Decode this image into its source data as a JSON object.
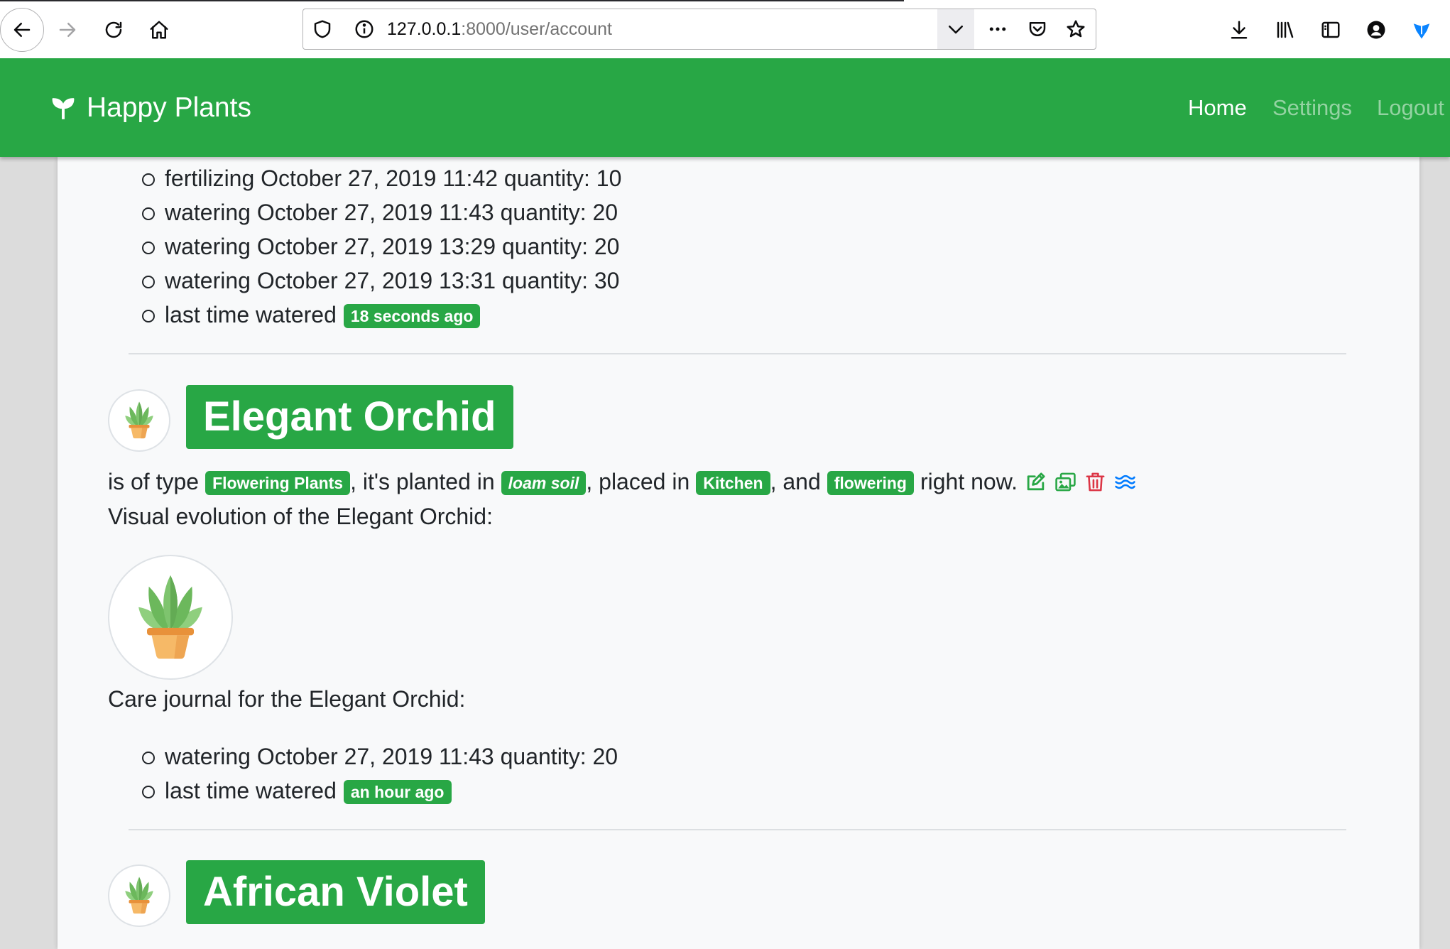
{
  "browser": {
    "url_host": "127.0.0.1",
    "url_rest": ":8000/user/account",
    "icons": [
      "back-icon",
      "forward-icon",
      "reload-icon",
      "home-icon",
      "shield-icon",
      "info-icon",
      "chevron-down-icon",
      "more-icon",
      "pocket-icon",
      "star-icon",
      "download-icon",
      "library-icon",
      "sidebar-icon",
      "account-icon",
      "extension-icon"
    ]
  },
  "theme": {
    "primary": "#28a745",
    "danger": "#dc3545",
    "info": "#007bff",
    "muted_link": "rgba(255,255,255,0.5)"
  },
  "navbar": {
    "brand": "Happy Plants",
    "brand_icon": "seedling-icon",
    "links": [
      {
        "label": "Home",
        "active": true
      },
      {
        "label": "Settings",
        "active": false
      },
      {
        "label": "Logout",
        "active": false
      }
    ]
  },
  "previous_plant": {
    "journal": [
      "fertilizing October 27, 2019 11:42 quantity: 10",
      "watering October 27, 2019 11:43 quantity: 20",
      "watering October 27, 2019 13:29 quantity: 20",
      "watering October 27, 2019 13:31 quantity: 30"
    ],
    "last_watered_label": "last time watered",
    "last_watered": "18 seconds ago"
  },
  "plants": [
    {
      "name": "Elegant Orchid",
      "avatar_icon": "potted-plant-icon",
      "description": {
        "type_prefix": "is of type",
        "type": "Flowering Plants",
        "soil_prefix": ", it's planted in",
        "soil": "loam soil",
        "location_prefix": ", placed in",
        "location": "Kitchen",
        "state_prefix": ", and",
        "state": "flowering",
        "suffix": "right now."
      },
      "actions": [
        "edit-icon",
        "images-icon",
        "trash-icon",
        "water-icon"
      ],
      "evolution_label": "Visual evolution of the Elegant Orchid:",
      "journal_label": "Care journal for the Elegant Orchid:",
      "journal": [
        "watering October 27, 2019 11:43 quantity: 20"
      ],
      "last_watered_label": "last time watered",
      "last_watered": "an hour ago"
    },
    {
      "name": "African Violet",
      "avatar_icon": "potted-plant-icon"
    }
  ]
}
